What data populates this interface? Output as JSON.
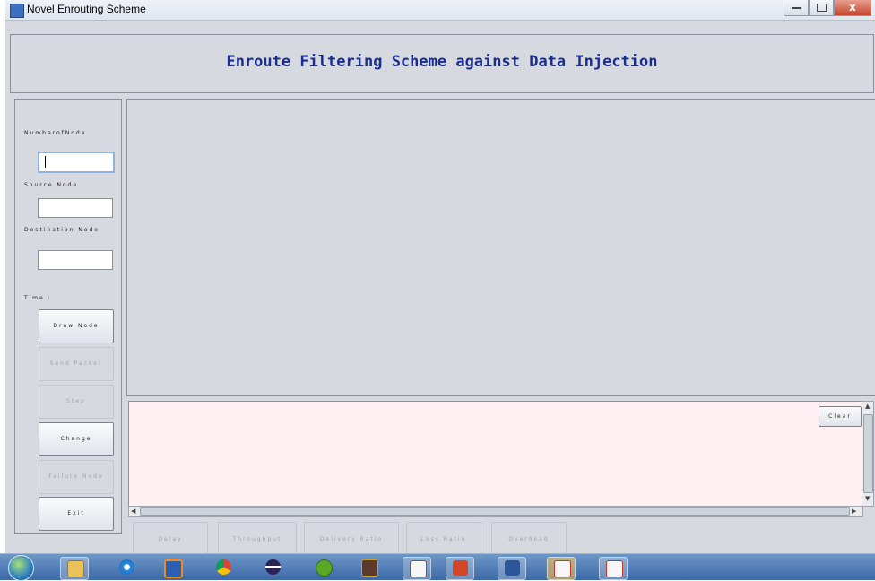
{
  "window": {
    "title": "Novel Enrouting Scheme"
  },
  "header": {
    "title": "Enroute Filtering Scheme against Data Injection"
  },
  "left_panel": {
    "number_of_node_label": "NumberofNode",
    "number_of_node_value": "",
    "source_node_label": "Source Node",
    "source_node_value": "",
    "destination_node_label": "Destination Node",
    "destination_node_value": "",
    "time_label": "Time :",
    "buttons": {
      "draw_node": "Draw Node",
      "send_packet": "Send Packet",
      "step": "Step",
      "change": "Change",
      "failure_node": "Failure Node",
      "exit": "Exit"
    }
  },
  "log": {
    "clear_label": "Clear",
    "content": ""
  },
  "metrics": {
    "delay": "Delay",
    "throughput": "Throughput",
    "delivery_ratio": "Delivery Ratio",
    "loss_ratio": "Loss Ratio",
    "overhead": "Overhead"
  },
  "taskbar": {
    "items": [
      "start-orb-icon",
      "explorer-icon",
      "ie-icon",
      "media-player-icon",
      "chrome-icon",
      "eclipse-icon",
      "utorrent-icon",
      "code-ide-icon",
      "java-icon",
      "powerpoint-icon",
      "word-icon",
      "java-icon",
      "java-icon"
    ]
  },
  "colors": {
    "header_title": "#1a2d8c",
    "log_background": "#fff0f4",
    "panel": "#d6d9e0"
  }
}
